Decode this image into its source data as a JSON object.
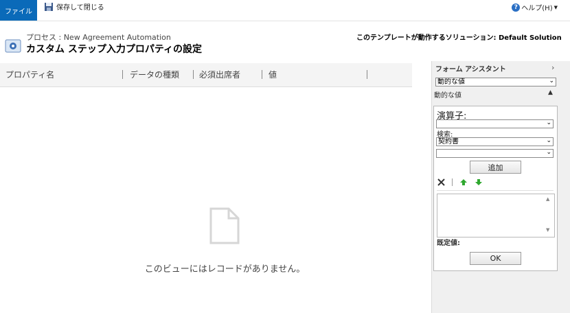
{
  "ribbon": {
    "file_tab": "ファイル",
    "save_close": "保存して閉じる",
    "help": "ヘルプ(H)"
  },
  "header": {
    "breadcrumb": "プロセス : New Agreement Automation",
    "title": "カスタム ステップ入力プロパティの設定",
    "solution": "このテンプレートが動作するソリューション: Default Solution"
  },
  "grid": {
    "columns": [
      "プロパティ名",
      "データの種類",
      "必須出席者",
      "値"
    ],
    "empty_message": "このビューにはレコードがありません。"
  },
  "form_assistant": {
    "title": "フォーム アシスタント",
    "top_select_value": "動的な値",
    "dynamic_label": "動的な値",
    "operator_label": "演算子:",
    "operator_value": "",
    "search_label": "検索:",
    "search_value": "契約書",
    "field_value": "",
    "add_button": "追加",
    "default_label": "既定値:",
    "ok_button": "OK"
  },
  "colors": {
    "file_tab": "#0a6ab9",
    "panel_bg": "#f0f0f0",
    "up_arrow": "#2fa82f",
    "down_arrow": "#2fa82f"
  }
}
